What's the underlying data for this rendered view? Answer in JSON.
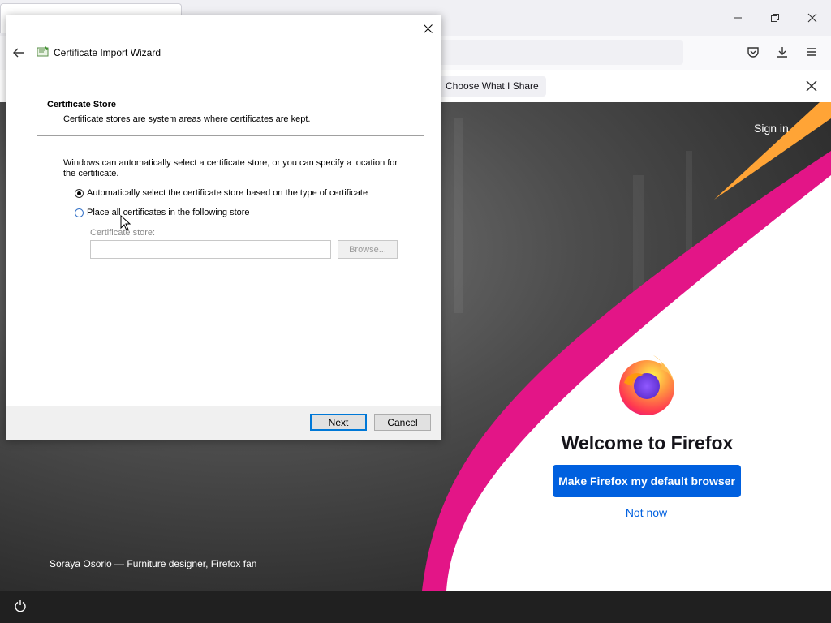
{
  "firefox": {
    "notification_button": "Choose What I Share",
    "signin": "Sign in",
    "welcome_title": "Welcome to Firefox",
    "default_button": "Make Firefox my default browser",
    "not_now": "Not now",
    "caption": "Soraya Osorio — Furniture designer, Firefox fan",
    "icons": {
      "minimize": "minimize-icon",
      "restore": "restore-icon",
      "close": "close-icon",
      "pocket": "pocket-icon",
      "downloads": "download-icon",
      "menu": "hamburger-menu-icon",
      "power": "power-icon"
    },
    "colors": {
      "accent": "#0060df",
      "pink": "#e31587",
      "orange": "#ff9f1c"
    }
  },
  "wizard": {
    "title": "Certificate Import Wizard",
    "section_heading": "Certificate Store",
    "section_description": "Certificate stores are system areas where certificates are kept.",
    "intro": "Windows can automatically select a certificate store, or you can specify a location for the certificate.",
    "option_auto": "Automatically select the certificate store based on the type of certificate",
    "option_manual": "Place all certificates in the following store",
    "store_label": "Certificate store:",
    "store_value": "",
    "browse_button": "Browse...",
    "next_button": "Next",
    "cancel_button": "Cancel",
    "selected_option": "auto"
  }
}
